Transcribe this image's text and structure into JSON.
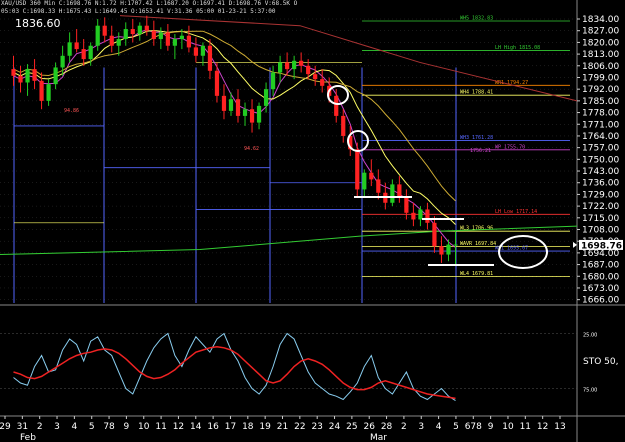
{
  "header": {
    "line1": "XAU/USD 360 Min  C:1698.76 N:1.72 H:1707.42 L:1687.20 O:1697.41 D:1698.76 V:68.5K O",
    "line2": "05:03 C:1698.33 H:1675.43 L:1649.45 O:1653.41 V:31.36 05:00 01-23-21 5:37:00"
  },
  "big_price": "1836.60",
  "colors": {
    "bull": "#22cc22",
    "bear": "#ff2222",
    "ma_yellow": "#ffff66",
    "ma_gold": "#ccaa33",
    "ma_maroon": "#aa3333",
    "ma_green": "#33cc33",
    "ma_purple": "#cc44cc",
    "pivot_blue": "#5566ff",
    "grid": "#333333",
    "stoch_fast": "#88ccee",
    "stoch_slow": "#ee2222"
  },
  "chart_data": [
    {
      "type": "candlestick",
      "ylim": [
        1664,
        1837
      ],
      "ticks": [
        "1834.00",
        "1827.00",
        "1820.00",
        "1813.00",
        "1806.00",
        "1799.00",
        "1792.00",
        "1785.00",
        "1778.00",
        "1771.00",
        "1764.00",
        "1757.00",
        "1750.00",
        "1743.00",
        "1736.00",
        "1729.00",
        "1722.00",
        "1715.00",
        "1708.00",
        "1701.00",
        "1694.00",
        "1687.00",
        "1680.00",
        "1673.00",
        "1666.00"
      ],
      "tick_values": [
        1834,
        1827,
        1820,
        1813,
        1806,
        1799,
        1792,
        1785,
        1778,
        1771,
        1764,
        1757,
        1750,
        1743,
        1736,
        1729,
        1722,
        1715,
        1708,
        1701,
        1694,
        1687,
        1680,
        1673,
        1666
      ],
      "current_price": {
        "label": "1698.76",
        "value": 1698.76
      },
      "levels": [
        {
          "label": "WH5 1832.83",
          "value": 1832.8,
          "color": "#33cc33"
        },
        {
          "label": "LH High 1815.08",
          "value": 1815.1,
          "color": "#33cc33"
        },
        {
          "label": "WR1 1794.27",
          "value": 1794.3,
          "color": "#ff8800"
        },
        {
          "label": "WH4 1788.41",
          "value": 1788.4,
          "color": "#ffff66"
        },
        {
          "label": "WH3 1761.28",
          "value": 1761.3,
          "color": "#5566ff"
        },
        {
          "label": "WP 1755.70",
          "value": 1755.7,
          "color": "#cc44cc"
        },
        {
          "label": "LH Low 1717.14",
          "value": 1717.1,
          "color": "#ff3333"
        },
        {
          "label": "WL3 1706.96",
          "value": 1707.0,
          "color": "#ffff66"
        },
        {
          "label": "WAVR 1697.84",
          "value": 1697.8,
          "color": "#ffff66"
        },
        {
          "label": "WS1 1695.07",
          "value": 1695.1,
          "color": "#5566ff"
        },
        {
          "label": "WL4 1679.81",
          "value": 1679.8,
          "color": "#ffff66"
        }
      ],
      "annotations": [
        "94.86",
        "94.62",
        "1756.21"
      ],
      "candles": [
        {
          "o": 1804,
          "h": 1812,
          "l": 1794,
          "c": 1800
        },
        {
          "o": 1800,
          "h": 1806,
          "l": 1790,
          "c": 1796
        },
        {
          "o": 1796,
          "h": 1807,
          "l": 1788,
          "c": 1804
        },
        {
          "o": 1804,
          "h": 1810,
          "l": 1792,
          "c": 1797
        },
        {
          "o": 1797,
          "h": 1802,
          "l": 1780,
          "c": 1785
        },
        {
          "o": 1785,
          "h": 1798,
          "l": 1782,
          "c": 1795
        },
        {
          "o": 1795,
          "h": 1808,
          "l": 1792,
          "c": 1805
        },
        {
          "o": 1805,
          "h": 1818,
          "l": 1800,
          "c": 1812
        },
        {
          "o": 1812,
          "h": 1826,
          "l": 1808,
          "c": 1820
        },
        {
          "o": 1820,
          "h": 1828,
          "l": 1814,
          "c": 1816
        },
        {
          "o": 1816,
          "h": 1822,
          "l": 1806,
          "c": 1810
        },
        {
          "o": 1810,
          "h": 1820,
          "l": 1806,
          "c": 1818
        },
        {
          "o": 1818,
          "h": 1834,
          "l": 1815,
          "c": 1830
        },
        {
          "o": 1830,
          "h": 1835,
          "l": 1820,
          "c": 1824
        },
        {
          "o": 1824,
          "h": 1830,
          "l": 1814,
          "c": 1818
        },
        {
          "o": 1818,
          "h": 1826,
          "l": 1812,
          "c": 1822
        },
        {
          "o": 1822,
          "h": 1832,
          "l": 1818,
          "c": 1828
        },
        {
          "o": 1828,
          "h": 1834,
          "l": 1820,
          "c": 1825
        },
        {
          "o": 1825,
          "h": 1832,
          "l": 1821,
          "c": 1830
        },
        {
          "o": 1830,
          "h": 1836,
          "l": 1824,
          "c": 1827
        },
        {
          "o": 1827,
          "h": 1833,
          "l": 1818,
          "c": 1822
        },
        {
          "o": 1822,
          "h": 1829,
          "l": 1816,
          "c": 1826
        },
        {
          "o": 1826,
          "h": 1831,
          "l": 1815,
          "c": 1818
        },
        {
          "o": 1818,
          "h": 1825,
          "l": 1810,
          "c": 1822
        },
        {
          "o": 1822,
          "h": 1828,
          "l": 1816,
          "c": 1824
        },
        {
          "o": 1824,
          "h": 1830,
          "l": 1814,
          "c": 1817
        },
        {
          "o": 1817,
          "h": 1823,
          "l": 1808,
          "c": 1812
        },
        {
          "o": 1812,
          "h": 1820,
          "l": 1806,
          "c": 1818
        },
        {
          "o": 1818,
          "h": 1822,
          "l": 1798,
          "c": 1803
        },
        {
          "o": 1803,
          "h": 1808,
          "l": 1784,
          "c": 1788
        },
        {
          "o": 1788,
          "h": 1795,
          "l": 1774,
          "c": 1779
        },
        {
          "o": 1779,
          "h": 1790,
          "l": 1776,
          "c": 1786
        },
        {
          "o": 1786,
          "h": 1792,
          "l": 1772,
          "c": 1776
        },
        {
          "o": 1776,
          "h": 1784,
          "l": 1770,
          "c": 1780
        },
        {
          "o": 1780,
          "h": 1786,
          "l": 1766,
          "c": 1772
        },
        {
          "o": 1772,
          "h": 1784,
          "l": 1768,
          "c": 1782
        },
        {
          "o": 1782,
          "h": 1796,
          "l": 1778,
          "c": 1792
        },
        {
          "o": 1792,
          "h": 1806,
          "l": 1788,
          "c": 1802
        },
        {
          "o": 1802,
          "h": 1812,
          "l": 1796,
          "c": 1808
        },
        {
          "o": 1808,
          "h": 1814,
          "l": 1800,
          "c": 1804
        },
        {
          "o": 1804,
          "h": 1812,
          "l": 1798,
          "c": 1809
        },
        {
          "o": 1809,
          "h": 1814,
          "l": 1802,
          "c": 1806
        },
        {
          "o": 1806,
          "h": 1810,
          "l": 1798,
          "c": 1801
        },
        {
          "o": 1801,
          "h": 1806,
          "l": 1794,
          "c": 1798
        },
        {
          "o": 1798,
          "h": 1804,
          "l": 1790,
          "c": 1794
        },
        {
          "o": 1794,
          "h": 1799,
          "l": 1784,
          "c": 1788
        },
        {
          "o": 1788,
          "h": 1792,
          "l": 1772,
          "c": 1776
        },
        {
          "o": 1776,
          "h": 1780,
          "l": 1760,
          "c": 1764
        },
        {
          "o": 1764,
          "h": 1770,
          "l": 1752,
          "c": 1756
        },
        {
          "o": 1756,
          "h": 1760,
          "l": 1728,
          "c": 1732
        },
        {
          "o": 1732,
          "h": 1744,
          "l": 1728,
          "c": 1742
        },
        {
          "o": 1742,
          "h": 1750,
          "l": 1734,
          "c": 1738
        },
        {
          "o": 1738,
          "h": 1744,
          "l": 1726,
          "c": 1730
        },
        {
          "o": 1730,
          "h": 1736,
          "l": 1720,
          "c": 1724
        },
        {
          "o": 1724,
          "h": 1738,
          "l": 1722,
          "c": 1735
        },
        {
          "o": 1735,
          "h": 1740,
          "l": 1724,
          "c": 1728
        },
        {
          "o": 1728,
          "h": 1732,
          "l": 1714,
          "c": 1718
        },
        {
          "o": 1718,
          "h": 1724,
          "l": 1710,
          "c": 1714
        },
        {
          "o": 1714,
          "h": 1722,
          "l": 1710,
          "c": 1720
        },
        {
          "o": 1720,
          "h": 1724,
          "l": 1708,
          "c": 1712
        },
        {
          "o": 1712,
          "h": 1716,
          "l": 1694,
          "c": 1698
        },
        {
          "o": 1698,
          "h": 1704,
          "l": 1688,
          "c": 1693
        },
        {
          "o": 1693,
          "h": 1702,
          "l": 1689,
          "c": 1699
        },
        {
          "o": 1699,
          "h": 1707,
          "l": 1687,
          "c": 1699
        }
      ]
    },
    {
      "type": "line",
      "name": "STO",
      "label": "STO  50,",
      "ylim": [
        0,
        100
      ],
      "ticks": [
        "25.00",
        "75.00"
      ],
      "tick_values": [
        75,
        25
      ],
      "series": [
        {
          "values": [
            35,
            30,
            28,
            45,
            55,
            40,
            42,
            60,
            70,
            65,
            50,
            68,
            72,
            60,
            55,
            40,
            25,
            20,
            35,
            50,
            62,
            70,
            75,
            55,
            45,
            60,
            72,
            65,
            58,
            70,
            75,
            60,
            50,
            35,
            25,
            20,
            28,
            45,
            65,
            75,
            70,
            55,
            40,
            30,
            25,
            20,
            18,
            15,
            22,
            30,
            45,
            55,
            35,
            25,
            20,
            30,
            40,
            25,
            18,
            15,
            20,
            25,
            18,
            14
          ]
        },
        {
          "values": [
            40,
            38,
            35,
            34,
            36,
            40,
            44,
            48,
            52,
            55,
            57,
            58,
            60,
            61,
            60,
            57,
            52,
            46,
            40,
            36,
            34,
            35,
            38,
            42,
            48,
            53,
            58,
            60,
            62,
            63,
            62,
            60,
            56,
            50,
            44,
            38,
            32,
            30,
            32,
            38,
            45,
            50,
            52,
            50,
            47,
            42,
            36,
            30,
            26,
            24,
            24,
            26,
            30,
            32,
            30,
            28,
            26,
            24,
            22,
            20,
            19,
            18,
            17,
            16
          ]
        }
      ]
    }
  ],
  "x_axis": {
    "day_labels": [
      "29",
      "31",
      "2",
      "3",
      "4",
      "5",
      "78",
      "9",
      "10",
      "11",
      "12",
      "14",
      "16",
      "17",
      "18",
      "19",
      "21",
      "22",
      "23",
      "24",
      "25",
      "26",
      "28",
      "2",
      "3",
      "4",
      "5",
      "678",
      "9",
      "10",
      "11",
      "12",
      "13"
    ],
    "month_labels": [
      "Feb",
      "Mar"
    ]
  }
}
